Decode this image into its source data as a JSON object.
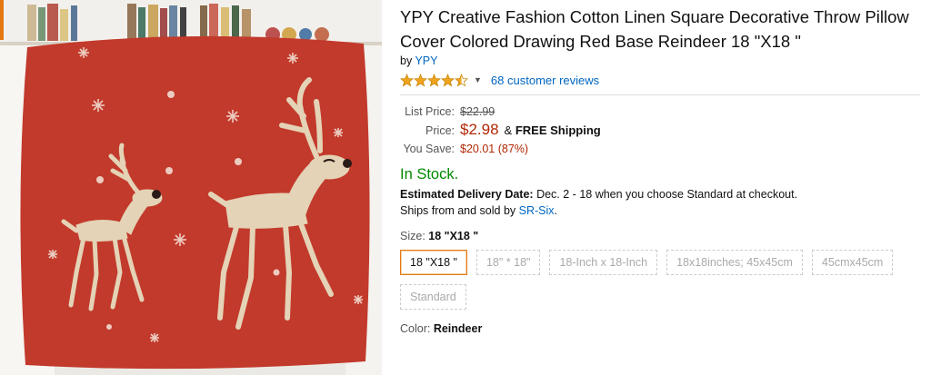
{
  "product": {
    "title": "YPY Creative Fashion Cotton Linen Square Decorative Throw Pillow Cover Colored Drawing Red Base Reindeer 18 \"X18 \"",
    "by_label": "by",
    "brand": "YPY",
    "rating": 4.5,
    "reviews_text": "68 customer reviews"
  },
  "pricing": {
    "list_label": "List Price:",
    "list_value": "$22.99",
    "price_label": "Price:",
    "price_value": "$2.98",
    "shipping_amp": "&",
    "shipping_text": "FREE Shipping",
    "save_label": "You Save:",
    "save_value": "$20.01 (87%)"
  },
  "availability": {
    "stock": "In Stock.",
    "delivery_label": "Estimated Delivery Date:",
    "delivery_text": "Dec. 2 - 18 when you choose Standard at checkout.",
    "ships_prefix": "Ships from and sold by",
    "seller": "SR-Six",
    "ships_suffix": "."
  },
  "size": {
    "label": "Size:",
    "selected": "18 \"X18 \"",
    "options": [
      "18 \"X18 \"",
      "18\" * 18\"",
      "18-Inch x 18-Inch",
      "18x18inches; 45x45cm",
      "45cmx45cm",
      "Standard"
    ]
  },
  "color": {
    "label": "Color:",
    "selected": "Reindeer"
  },
  "colors": {
    "pillow_red": "#c23a2c",
    "link": "#0066c0",
    "price": "#b12704",
    "stock": "#008a00",
    "selected_border": "#e47911"
  }
}
